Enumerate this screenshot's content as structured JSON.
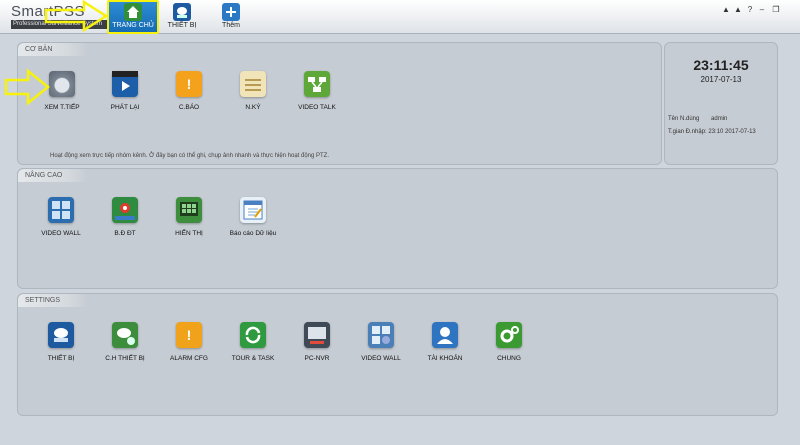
{
  "app": {
    "logo_text": "SmartPSS",
    "logo_subtitle": "Professional Surveillance System"
  },
  "tabs": [
    {
      "label": "TRANG CHỦ",
      "icon": "home-icon",
      "active": true
    },
    {
      "label": "THIẾT BỊ",
      "icon": "device-icon",
      "active": false
    },
    {
      "label": "Thêm",
      "icon": "add-icon",
      "active": false
    }
  ],
  "window_controls": {
    "user": "▲",
    "lock": "▲",
    "help": "?",
    "minimize": "–",
    "restore": "❐"
  },
  "basic": {
    "title": "CƠ BẢN",
    "items": [
      {
        "label": "XEM T.TIẾP",
        "icon": "live-view-icon"
      },
      {
        "label": "PHÁT LẠI",
        "icon": "playback-icon"
      },
      {
        "label": "C.BÁO",
        "icon": "alarm-icon"
      },
      {
        "label": "N.KÝ",
        "icon": "log-icon"
      },
      {
        "label": "VIDEO TALK",
        "icon": "video-talk-icon"
      }
    ],
    "description": "Hoạt động xem trực tiếp nhóm kênh. Ở đây bạn có thể ghi, chụp ảnh nhanh và thực hiện hoạt động PTZ."
  },
  "clock": {
    "time": "23:11:45",
    "date": "2017-07-13",
    "user_label": "Tên N.dùng",
    "user_value": "admin",
    "login_label": "T.gian Đ.nhập:",
    "login_value": "23:10 2017-07-13"
  },
  "advanced": {
    "title": "NÂNG CAO",
    "items": [
      {
        "label": "VIDEO WALL",
        "icon": "video-wall-icon"
      },
      {
        "label": "B.Đ ĐT",
        "icon": "emap-icon"
      },
      {
        "label": "HIỂN THỊ",
        "icon": "display-icon"
      },
      {
        "label": "Báo cáo Dữ liệu",
        "icon": "data-report-icon"
      }
    ]
  },
  "settings": {
    "title": "SETTINGS",
    "items": [
      {
        "label": "THIẾT BỊ",
        "icon": "device-settings-icon"
      },
      {
        "label": "C.H THIẾT BỊ",
        "icon": "device-config-icon"
      },
      {
        "label": "ALARM CFG",
        "icon": "alarm-config-icon"
      },
      {
        "label": "TOUR & TASK",
        "icon": "tour-task-icon"
      },
      {
        "label": "PC-NVR",
        "icon": "pc-nvr-icon"
      },
      {
        "label": "VIDEO WALL",
        "icon": "video-wall-settings-icon"
      },
      {
        "label": "TÀI KHOẢN",
        "icon": "account-icon"
      },
      {
        "label": "CHUNG",
        "icon": "general-icon"
      }
    ]
  },
  "colors": {
    "accent": "#1f7fd0",
    "arrow": "#f6f20d",
    "panel": "#c6ccd3"
  }
}
